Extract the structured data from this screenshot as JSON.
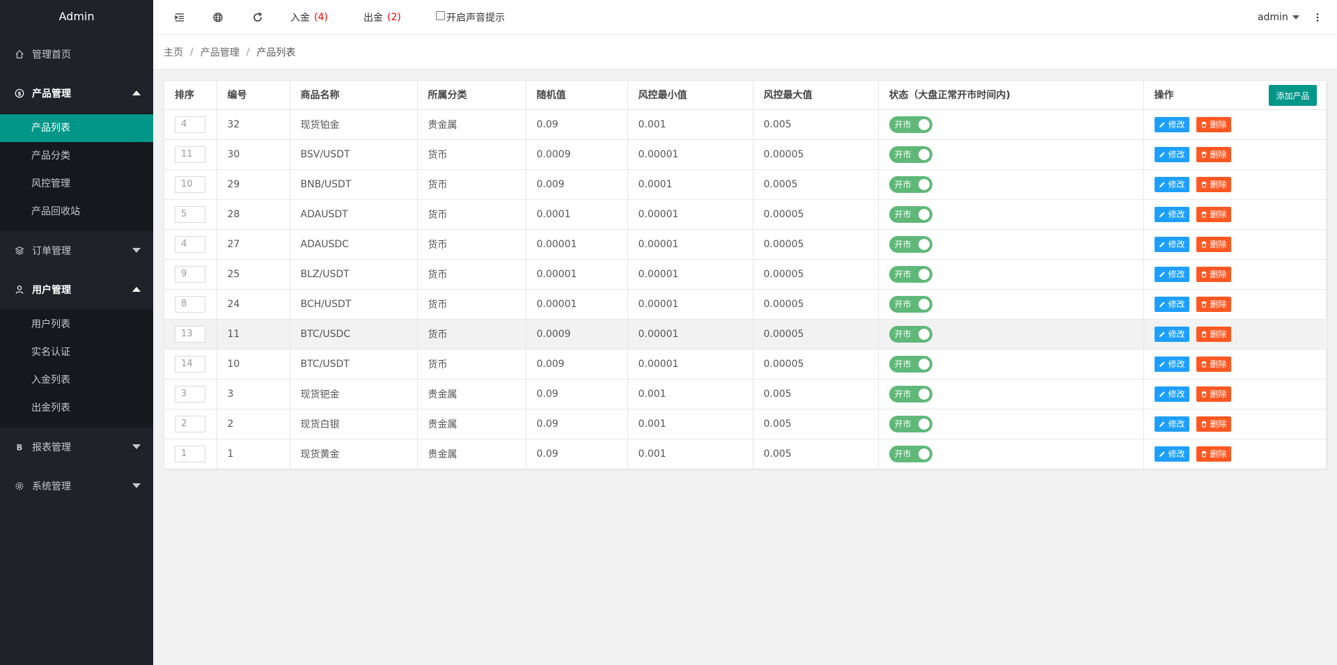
{
  "sidebar": {
    "title": "Admin",
    "home": "管理首页",
    "product_group": "产品管理",
    "product_items": [
      "产品列表",
      "产品分类",
      "风控管理",
      "产品回收站"
    ],
    "order_group": "订单管理",
    "user_group": "用户管理",
    "user_items": [
      "用户列表",
      "实名认证",
      "入金列表",
      "出金列表"
    ],
    "report_group": "报表管理",
    "system_group": "系统管理"
  },
  "header": {
    "deposit_label": "入金",
    "deposit_count": "(4)",
    "withdraw_label": "出金",
    "withdraw_count": "(2)",
    "sound_label": "开启声音提示",
    "user": "admin"
  },
  "breadcrumb": [
    "主页",
    "产品管理",
    "产品列表"
  ],
  "table": {
    "headers": [
      "排序",
      "编号",
      "商品名称",
      "所属分类",
      "随机值",
      "风控最小值",
      "风控最大值",
      "状态（大盘正常开市时间内)",
      "操作"
    ],
    "add_label": "添加产品",
    "switch_label": "开市",
    "edit_label": "修改",
    "delete_label": "删除",
    "rows": [
      {
        "sort": "4",
        "id": "32",
        "name": "现货铂金",
        "category": "贵金属",
        "random": "0.09",
        "min": "0.001",
        "max": "0.005"
      },
      {
        "sort": "11",
        "id": "30",
        "name": "BSV/USDT",
        "category": "货币",
        "random": "0.0009",
        "min": "0.00001",
        "max": "0.00005"
      },
      {
        "sort": "10",
        "id": "29",
        "name": "BNB/USDT",
        "category": "货币",
        "random": "0.009",
        "min": "0.0001",
        "max": "0.0005"
      },
      {
        "sort": "5",
        "id": "28",
        "name": "ADAUSDT",
        "category": "货币",
        "random": "0.0001",
        "min": "0.00001",
        "max": "0.00005"
      },
      {
        "sort": "4",
        "id": "27",
        "name": "ADAUSDC",
        "category": "货币",
        "random": "0.00001",
        "min": "0.00001",
        "max": "0.00005"
      },
      {
        "sort": "9",
        "id": "25",
        "name": "BLZ/USDT",
        "category": "货币",
        "random": "0.00001",
        "min": "0.00001",
        "max": "0.00005"
      },
      {
        "sort": "8",
        "id": "24",
        "name": "BCH/USDT",
        "category": "货币",
        "random": "0.00001",
        "min": "0.00001",
        "max": "0.00005"
      },
      {
        "sort": "13",
        "id": "11",
        "name": "BTC/USDC",
        "category": "货币",
        "random": "0.0009",
        "min": "0.00001",
        "max": "0.00005"
      },
      {
        "sort": "14",
        "id": "10",
        "name": "BTC/USDT",
        "category": "货币",
        "random": "0.009",
        "min": "0.00001",
        "max": "0.00005"
      },
      {
        "sort": "3",
        "id": "3",
        "name": "现货钯金",
        "category": "贵金属",
        "random": "0.09",
        "min": "0.001",
        "max": "0.005"
      },
      {
        "sort": "2",
        "id": "2",
        "name": "现货白银",
        "category": "贵金属",
        "random": "0.09",
        "min": "0.001",
        "max": "0.005"
      },
      {
        "sort": "1",
        "id": "1",
        "name": "现货黄金",
        "category": "贵金属",
        "random": "0.09",
        "min": "0.001",
        "max": "0.005"
      }
    ]
  },
  "colors": {
    "sidebar_bg": "#20222a",
    "active_item": "#009688",
    "switch_on": "#5fb878",
    "edit_btn": "#1e9fff",
    "delete_btn": "#ff5722"
  }
}
